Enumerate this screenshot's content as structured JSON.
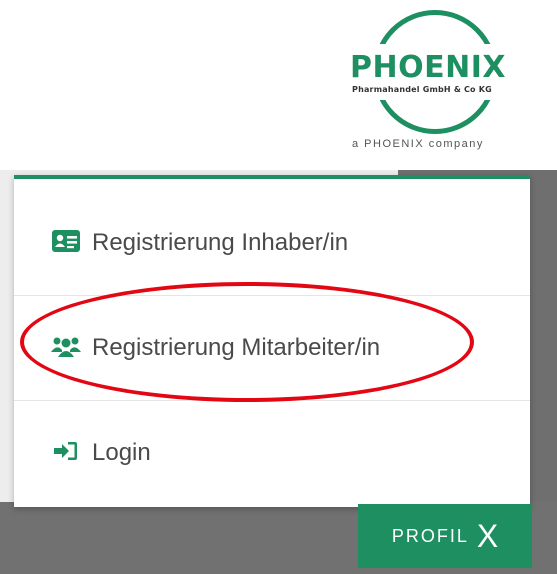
{
  "logo": {
    "brand": "PHOENIX",
    "subtitle": "Pharmahandel GmbH & Co KG",
    "tagline": "a PHOENIX company"
  },
  "menu": {
    "items": [
      {
        "label": "Registrierung Inhaber/in",
        "icon": "id-card-icon"
      },
      {
        "label": "Registrierung Mitarbeiter/in",
        "icon": "users-icon"
      },
      {
        "label": "Login",
        "icon": "sign-in-icon"
      }
    ]
  },
  "profil_button": {
    "label": "PROFIL",
    "close": "X"
  },
  "colors": {
    "brand_green": "#1e8f61",
    "highlight_red": "#e30613",
    "text": "#4a4a4a"
  }
}
